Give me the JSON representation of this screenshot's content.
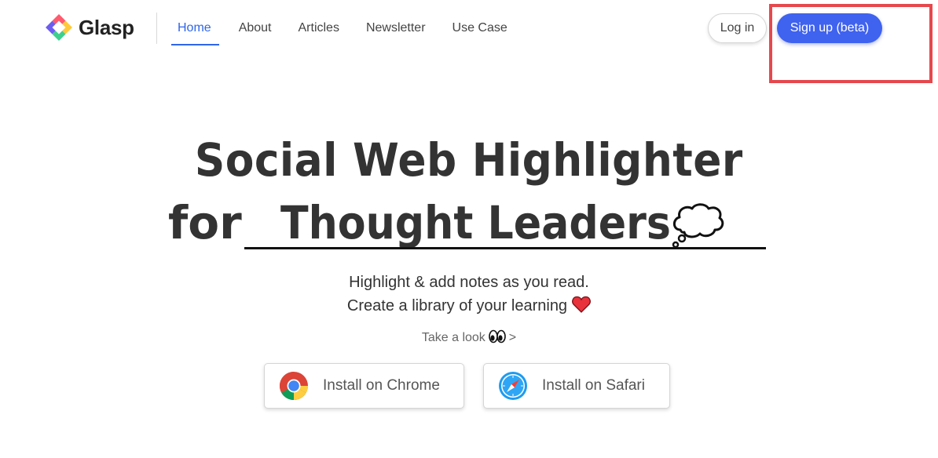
{
  "brand": {
    "name": "Glasp"
  },
  "nav": {
    "items": [
      {
        "label": "Home",
        "active": true
      },
      {
        "label": "About"
      },
      {
        "label": "Articles"
      },
      {
        "label": "Newsletter"
      },
      {
        "label": "Use Case"
      }
    ]
  },
  "auth": {
    "login_label": "Log in",
    "signup_label": "Sign up (beta)"
  },
  "hero": {
    "line1": "Social Web Highlighter",
    "for": "for",
    "rotating_text": "Thought Leaders",
    "rotating_icon": "thought-bubble-icon",
    "subtitle_line1": "Highlight & add notes as you read.",
    "subtitle_line2": "Create a library of your learning",
    "subtitle_icon": "heart-icon",
    "take_look": "Take a look",
    "take_look_icon": "eyes-icon",
    "take_look_suffix": ">"
  },
  "install": {
    "chrome_label": "Install on Chrome",
    "safari_label": "Install on Safari"
  },
  "colors": {
    "accent": "#3f62ef",
    "nav_active": "#2f66e8",
    "highlight_box": "#e5484d",
    "heart": "#e8323c"
  }
}
